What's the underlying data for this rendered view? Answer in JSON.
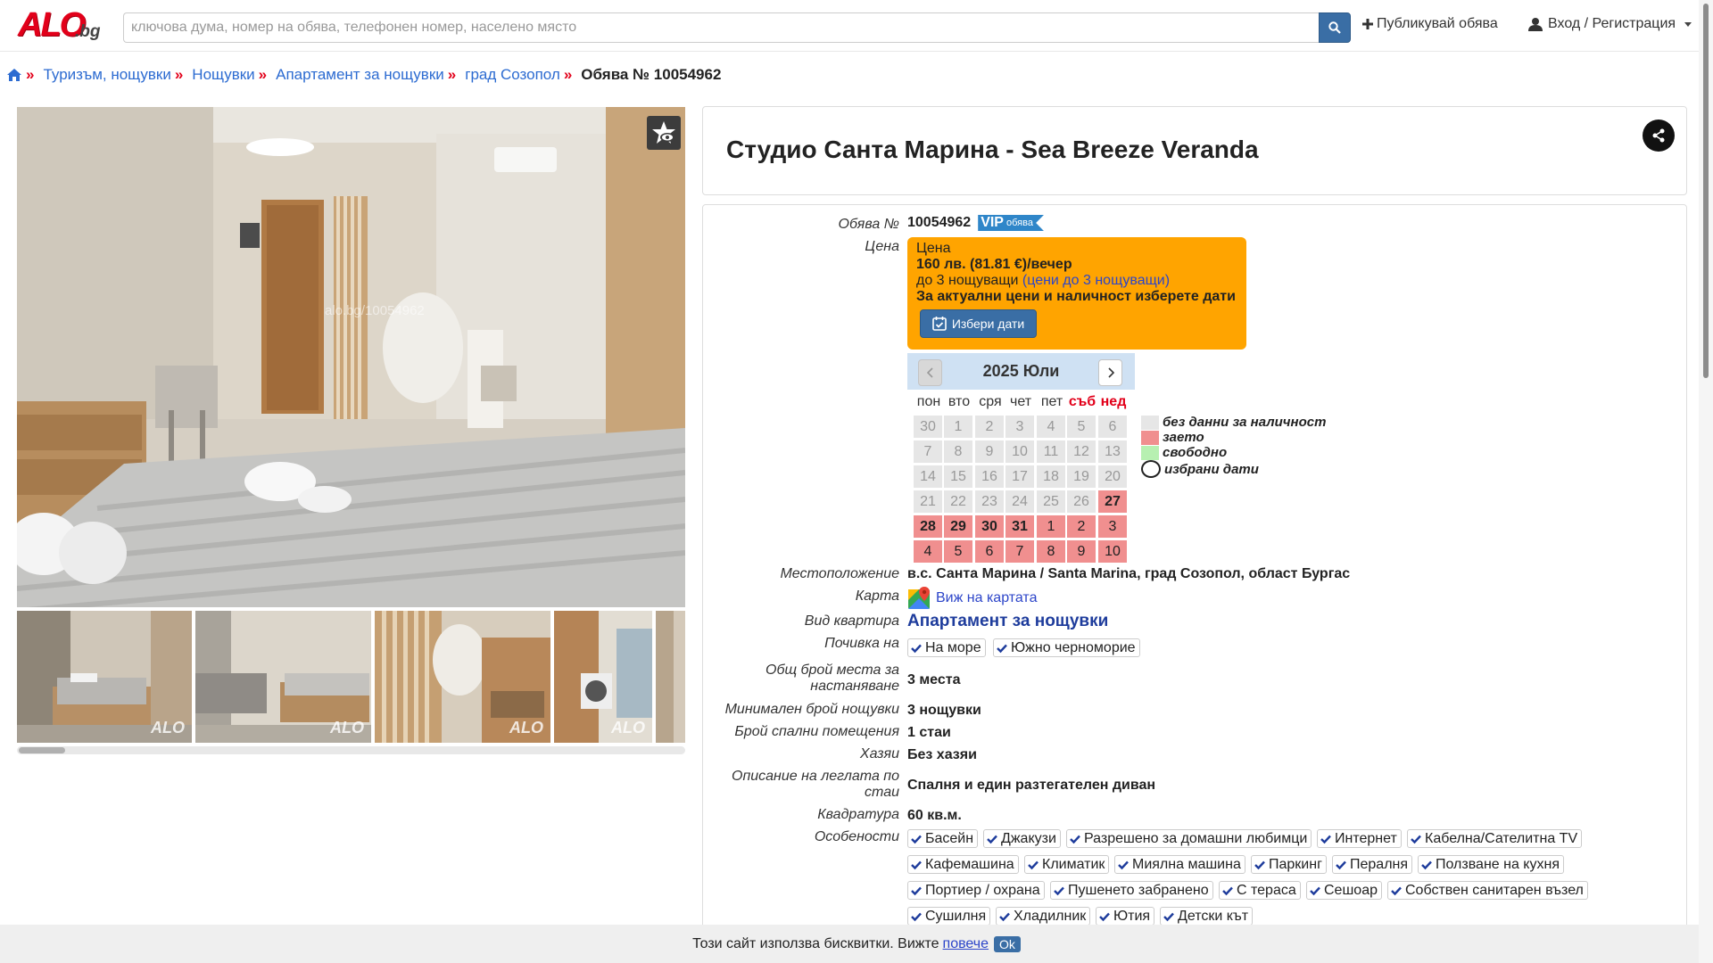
{
  "colors": {
    "brand_red": "#e2001a",
    "accent_blue": "#3a6ea5",
    "price_bg": "#ffa400",
    "busy": "#f08f8f",
    "free": "#b7f0b1",
    "no_data": "#e6e6e6"
  },
  "header": {
    "logo_main": "ALO",
    "logo_suffix": ".bg",
    "search_placeholder": "ключова дума, номер на обява, телефонен номер, населено място",
    "search_icon": "search-icon",
    "publish_label": "Публикувай обява",
    "login_label": "Вход / Регистрация"
  },
  "breadcrumb": {
    "items": [
      "Туризъм, нощувки",
      "Нощувки",
      "Апартамент за нощувки",
      "град Созопол"
    ],
    "current": "Обява № 10054962"
  },
  "gallery": {
    "watermark": "alo.bg/10054962",
    "thumb_logo": "ALO"
  },
  "listing": {
    "title": "Студио Санта Марина - Sea Breeze Veranda"
  },
  "details": {
    "ad_no_label": "Обява №",
    "ad_no": "10054962",
    "vip_big": "VIP",
    "vip_small": "обява",
    "price_label": "Цена",
    "price_box_title": "Цена",
    "price_main": "160 лв. (81.81 €)/вечер",
    "price_guests": "до 3 нощуващи",
    "price_link": "(цени до 3 нощуващи)",
    "price_note": "За актуални цени и наличност изберете дати",
    "dates_button": "Избери дати",
    "location_label": "Местоположение",
    "location": "в.с. Санта Марина / Santa Marina, град Созопол, област Бургас",
    "map_label": "Карта",
    "map_link": "Виж на картата",
    "type_label": "Вид квартира",
    "type": "Апартамент за нощувки",
    "vacation_label": "Почивка на",
    "vacation": [
      "На море",
      "Южно черноморие"
    ],
    "beds_label_1": "Общ брой места за",
    "beds_label_2": "настаняване",
    "beds": "3 места",
    "min_nights_label": "Минимален брой нощувки",
    "min_nights": "3 нощувки",
    "bedrooms_label": "Брой спални помещения",
    "bedrooms": "1 стаи",
    "meals_label": "Хазяи",
    "meals": "Без хазяи",
    "bed_desc_label_1": "Описание на леглата по",
    "bed_desc_label_2": "стаи",
    "bed_desc": "Спалня и един разтегателен диван",
    "area_label": "Квадратура",
    "area": "60 кв.м.",
    "features_label": "Особености",
    "features": [
      [
        "Басейн",
        "Джакузи",
        "Разрешено за домашни любимци",
        "Интернет",
        "Кабелна/Сателитна TV"
      ],
      [
        "Кафемашина",
        "Климатик",
        "Миялна машина",
        "Паркинг",
        "Пералня",
        "Ползване на кухня"
      ],
      [
        "Портиер / охрана",
        "Пушенето забранено",
        "С тераса",
        "Сешоар",
        "Собствен санитарен възел"
      ],
      [
        "Сушилня",
        "Хладилник",
        "Ютия",
        "Детски кът"
      ]
    ]
  },
  "calendar": {
    "month_title": "2025 Юли",
    "weekdays": [
      "пон",
      "вто",
      "сря",
      "чет",
      "пет",
      "съб",
      "нед"
    ],
    "days": [
      [
        "30",
        "1",
        "2",
        "3",
        "4",
        "5",
        "6"
      ],
      [
        "7",
        "8",
        "9",
        "10",
        "11",
        "12",
        "13"
      ],
      [
        "14",
        "15",
        "16",
        "17",
        "18",
        "19",
        "20"
      ],
      [
        "21",
        "22",
        "23",
        "24",
        "25",
        "26",
        "27"
      ],
      [
        "28",
        "29",
        "30",
        "31",
        "1",
        "2",
        "3"
      ],
      [
        "4",
        "5",
        "6",
        "7",
        "8",
        "9",
        "10"
      ]
    ],
    "legend": [
      "без данни за наличност",
      "заето",
      "свободно",
      "избрани дати"
    ]
  },
  "cookie": {
    "text": "Този сайт използва бисквитки. Вижте",
    "link": "повече",
    "ok": "Ok"
  }
}
